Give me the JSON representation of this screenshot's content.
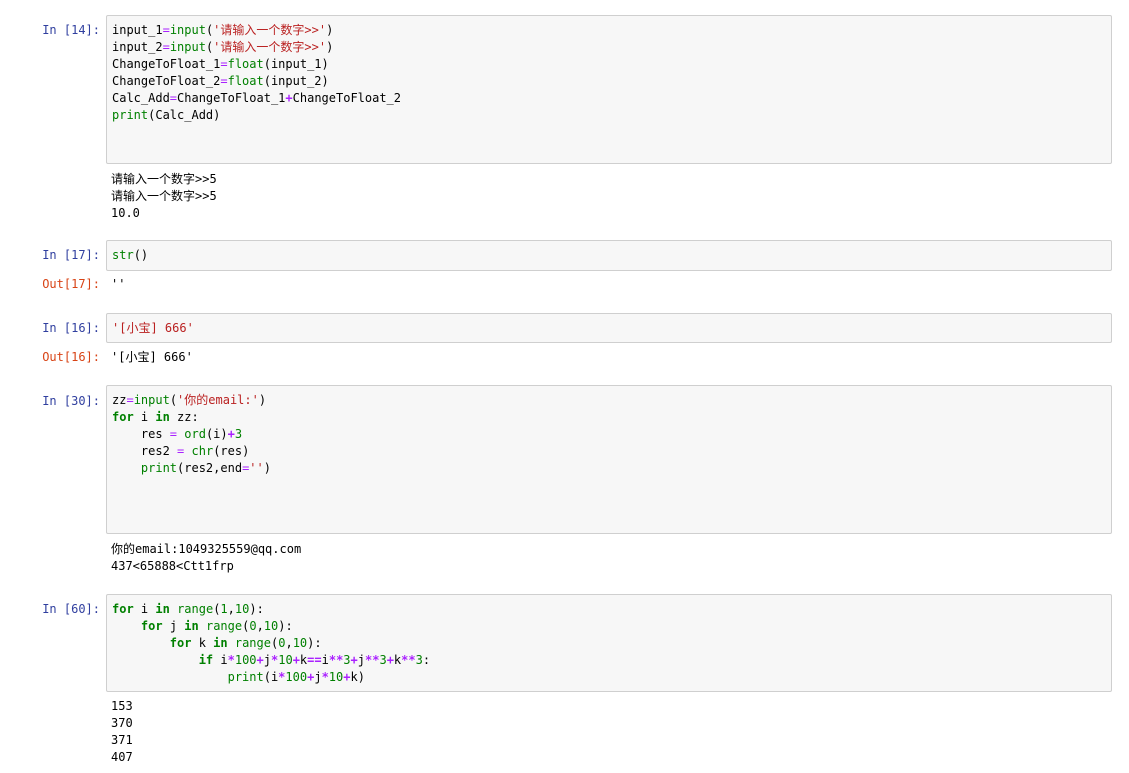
{
  "cells": [
    {
      "prompt": "In  [14]:",
      "input_lines": [
        [
          [
            "pl",
            "input_1"
          ],
          [
            "eq",
            "="
          ],
          [
            "bi",
            "input"
          ],
          [
            "pl",
            "("
          ],
          [
            "str",
            "'请输入一个数字>>'"
          ],
          [
            "pl",
            ")"
          ]
        ],
        [
          [
            "pl",
            "input_2"
          ],
          [
            "eq",
            "="
          ],
          [
            "bi",
            "input"
          ],
          [
            "pl",
            "("
          ],
          [
            "str",
            "'请输入一个数字>>'"
          ],
          [
            "pl",
            ")"
          ]
        ],
        [
          [
            "pl",
            "ChangeToFloat_1"
          ],
          [
            "eq",
            "="
          ],
          [
            "bi",
            "float"
          ],
          [
            "pl",
            "(input_1)"
          ]
        ],
        [
          [
            "pl",
            "ChangeToFloat_2"
          ],
          [
            "eq",
            "="
          ],
          [
            "bi",
            "float"
          ],
          [
            "pl",
            "(input_2)"
          ]
        ],
        [
          [
            "pl",
            "Calc_Add"
          ],
          [
            "eq",
            "="
          ],
          [
            "pl",
            "ChangeToFloat_1"
          ],
          [
            "op",
            "+"
          ],
          [
            "pl",
            "ChangeToFloat_2"
          ]
        ],
        [
          [
            "bi",
            "print"
          ],
          [
            "pl",
            "(Calc_Add)"
          ]
        ]
      ],
      "out_prompt": "",
      "output_lines": [
        "请输入一个数字>>5",
        "请输入一个数字>>5",
        "10.0"
      ]
    },
    {
      "prompt": "In  [17]:",
      "input_lines": [
        [
          [
            "bi",
            "str"
          ],
          [
            "pl",
            "()"
          ]
        ]
      ],
      "out_prompt": "Out[17]:",
      "output_lines": [
        "''"
      ]
    },
    {
      "prompt": "In  [16]:",
      "input_lines": [
        [
          [
            "str",
            "'[小宝] 666'"
          ]
        ]
      ],
      "out_prompt": "Out[16]:",
      "output_lines": [
        "'[小宝] 666'"
      ]
    },
    {
      "prompt": "In  [30]:",
      "input_lines": [
        [
          [
            "pl",
            "zz"
          ],
          [
            "eq",
            "="
          ],
          [
            "bi",
            "input"
          ],
          [
            "pl",
            "("
          ],
          [
            "str",
            "'你的email:'"
          ],
          [
            "pl",
            ")"
          ]
        ],
        [
          [
            "kw",
            "for"
          ],
          [
            "pl",
            " i "
          ],
          [
            "kw",
            "in"
          ],
          [
            "pl",
            " zz:"
          ]
        ],
        [
          [
            "pl",
            "    res "
          ],
          [
            "eq",
            "="
          ],
          [
            "pl",
            " "
          ],
          [
            "bi",
            "ord"
          ],
          [
            "pl",
            "(i)"
          ],
          [
            "op",
            "+"
          ],
          [
            "num",
            "3"
          ]
        ],
        [
          [
            "pl",
            "    res2 "
          ],
          [
            "eq",
            "="
          ],
          [
            "pl",
            " "
          ],
          [
            "bi",
            "chr"
          ],
          [
            "pl",
            "(res)"
          ]
        ],
        [
          [
            "pl",
            "    "
          ],
          [
            "bi",
            "print"
          ],
          [
            "pl",
            "(res2,end"
          ],
          [
            "eq",
            "="
          ],
          [
            "str",
            "''"
          ],
          [
            "pl",
            ")"
          ]
        ]
      ],
      "out_prompt": "",
      "output_lines": [
        "你的email:1049325559@qq.com",
        "437<65888<Ctt1frp"
      ]
    },
    {
      "prompt": "In  [60]:",
      "input_lines": [
        [
          [
            "kw",
            "for"
          ],
          [
            "pl",
            " i "
          ],
          [
            "kw",
            "in"
          ],
          [
            "pl",
            " "
          ],
          [
            "bi",
            "range"
          ],
          [
            "pl",
            "("
          ],
          [
            "num",
            "1"
          ],
          [
            "pl",
            ","
          ],
          [
            "num",
            "10"
          ],
          [
            "pl",
            "):"
          ]
        ],
        [
          [
            "pl",
            "    "
          ],
          [
            "kw",
            "for"
          ],
          [
            "pl",
            " j "
          ],
          [
            "kw",
            "in"
          ],
          [
            "pl",
            " "
          ],
          [
            "bi",
            "range"
          ],
          [
            "pl",
            "("
          ],
          [
            "num",
            "0"
          ],
          [
            "pl",
            ","
          ],
          [
            "num",
            "10"
          ],
          [
            "pl",
            "):"
          ]
        ],
        [
          [
            "pl",
            "        "
          ],
          [
            "kw",
            "for"
          ],
          [
            "pl",
            " k "
          ],
          [
            "kw",
            "in"
          ],
          [
            "pl",
            " "
          ],
          [
            "bi",
            "range"
          ],
          [
            "pl",
            "("
          ],
          [
            "num",
            "0"
          ],
          [
            "pl",
            ","
          ],
          [
            "num",
            "10"
          ],
          [
            "pl",
            "):"
          ]
        ],
        [
          [
            "pl",
            "            "
          ],
          [
            "kw",
            "if"
          ],
          [
            "pl",
            " i"
          ],
          [
            "op",
            "*"
          ],
          [
            "num",
            "100"
          ],
          [
            "op",
            "+"
          ],
          [
            "pl",
            "j"
          ],
          [
            "op",
            "*"
          ],
          [
            "num",
            "10"
          ],
          [
            "op",
            "+"
          ],
          [
            "pl",
            "k"
          ],
          [
            "op",
            "=="
          ],
          [
            "pl",
            "i"
          ],
          [
            "op",
            "**"
          ],
          [
            "num",
            "3"
          ],
          [
            "op",
            "+"
          ],
          [
            "pl",
            "j"
          ],
          [
            "op",
            "**"
          ],
          [
            "num",
            "3"
          ],
          [
            "op",
            "+"
          ],
          [
            "pl",
            "k"
          ],
          [
            "op",
            "**"
          ],
          [
            "num",
            "3"
          ],
          [
            "pl",
            ":"
          ]
        ],
        [
          [
            "pl",
            "                "
          ],
          [
            "bi",
            "print"
          ],
          [
            "pl",
            "(i"
          ],
          [
            "op",
            "*"
          ],
          [
            "num",
            "100"
          ],
          [
            "op",
            "+"
          ],
          [
            "pl",
            "j"
          ],
          [
            "op",
            "*"
          ],
          [
            "num",
            "10"
          ],
          [
            "op",
            "+"
          ],
          [
            "pl",
            "k)"
          ]
        ]
      ],
      "out_prompt": "",
      "output_lines": [
        "153",
        "370",
        "371",
        "407"
      ]
    }
  ],
  "colors": {
    "in_prompt": "#303f9f",
    "out_prompt": "#d84315",
    "keyword": "#008000",
    "string": "#ba2121",
    "operator": "#aa22ff",
    "cell_background": "#f7f7f7",
    "cell_border": "#cfcfcf"
  }
}
